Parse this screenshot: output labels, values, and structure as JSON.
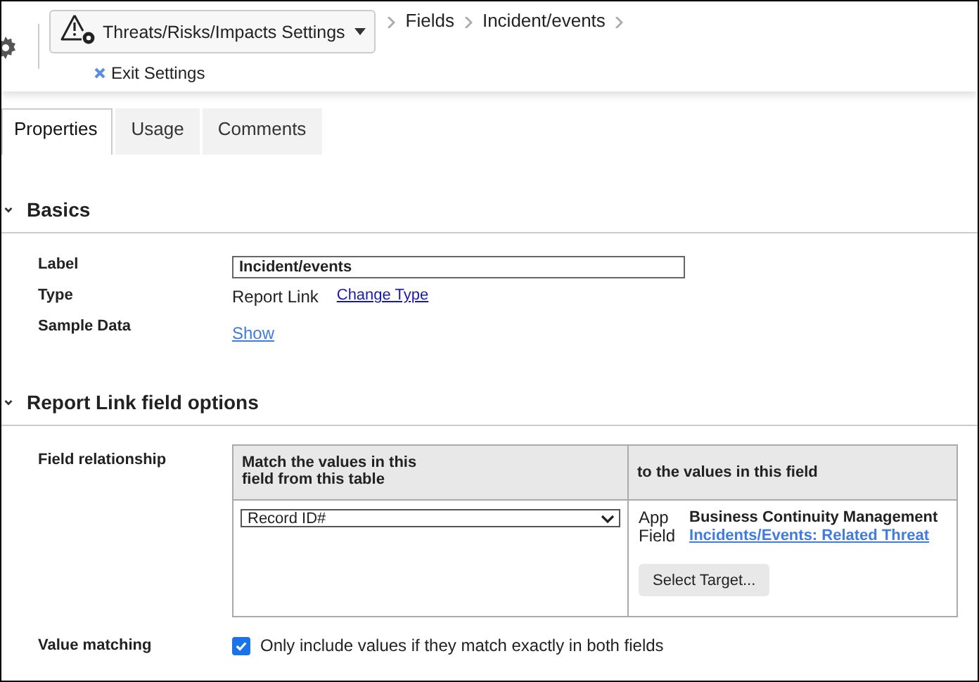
{
  "header": {
    "settings_menu": {
      "label": "Threats/Risks/Impacts Settings"
    },
    "breadcrumbs": [
      "Fields",
      "Incident/events"
    ],
    "exit_link": "Exit Settings"
  },
  "tabs": [
    {
      "label": "Properties",
      "selected": true
    },
    {
      "label": "Usage",
      "selected": false
    },
    {
      "label": "Comments",
      "selected": false
    }
  ],
  "basics": {
    "title": "Basics",
    "fields": [
      {
        "label": "Label",
        "kind": "input",
        "value": "Incident/events"
      },
      {
        "label": "Type",
        "kind": "text",
        "value": "Report Link",
        "link": "Change Type"
      },
      {
        "label": "Sample Data",
        "kind": "link",
        "link": "Show"
      }
    ]
  },
  "report_link_options": {
    "title": "Report Link field options",
    "field_relationship": {
      "label": "Field relationship",
      "columns": [
        "Match the values in this\nfield from this table",
        "to the values in this field"
      ],
      "source_select": "Record ID#",
      "target": {
        "app_label": "App",
        "field_label": "Field",
        "app": "Business Continuity Management",
        "field": "Incidents/Events: Related Threat",
        "button": "Select Target..."
      }
    },
    "value_matching": {
      "label": "Value matching",
      "checked": true,
      "text": "Only include values if they match exactly in both fields"
    }
  }
}
